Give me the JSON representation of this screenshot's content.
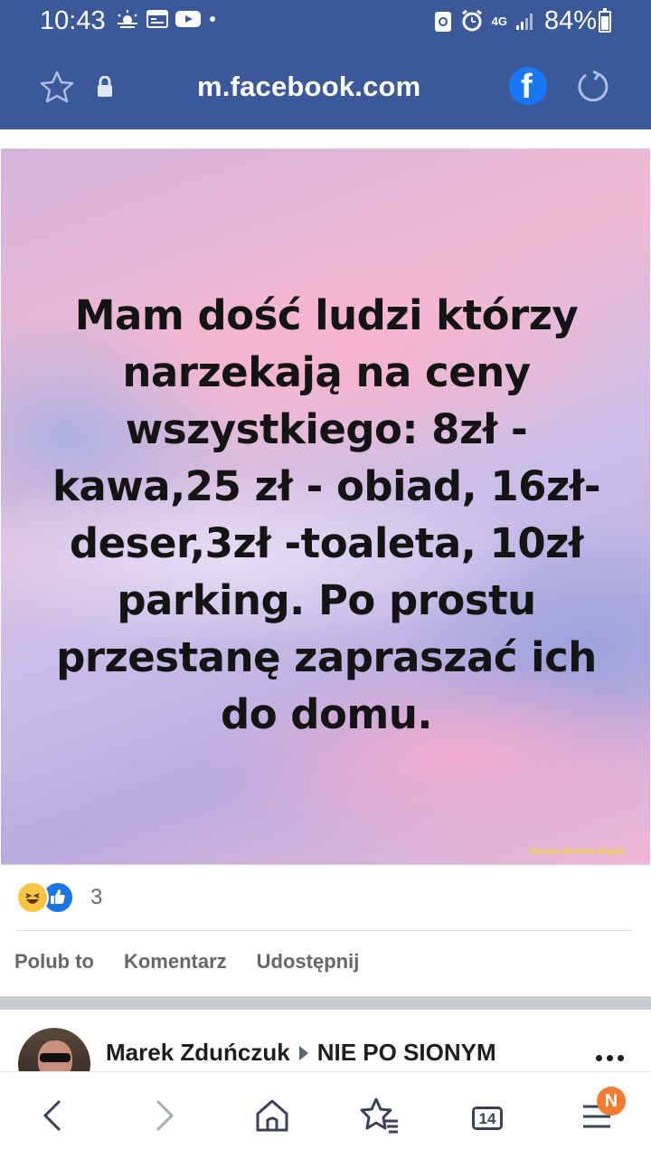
{
  "status_bar": {
    "time": "10:43",
    "network": "4G",
    "battery": "84%",
    "battery_level": 0.84
  },
  "browser": {
    "url": "m.facebook.com",
    "icons": [
      "star-icon",
      "lock-icon",
      "facebook-icon",
      "reload-icon"
    ]
  },
  "post": {
    "image_text": "Mam dość ludzi którzy\nnarzekają na ceny\nwszystkiego: 8zł -\nkawa,25 zł - obiad, 16zł-\ndeser,3zł -toaleta, 10zł\nparking. Po prostu\nprzestanę zapraszać ich\ndo domu.",
    "watermark": "Renata Mizerka Blaski",
    "reaction_count": "3",
    "reactions": [
      "haha",
      "like"
    ],
    "actions": {
      "like": "Polub to",
      "comment": "Komentarz",
      "share": "Udostępnij"
    }
  },
  "next_post": {
    "author": "Marek Zduńczuk",
    "group": "NIE PO SIONYM"
  },
  "bottom_nav": {
    "tabs_count": "14",
    "notification_badge": "N"
  },
  "colors": {
    "header_bg": "#3b5998",
    "facebook_blue": "#1877f2",
    "badge_orange": "#f47a2f"
  }
}
